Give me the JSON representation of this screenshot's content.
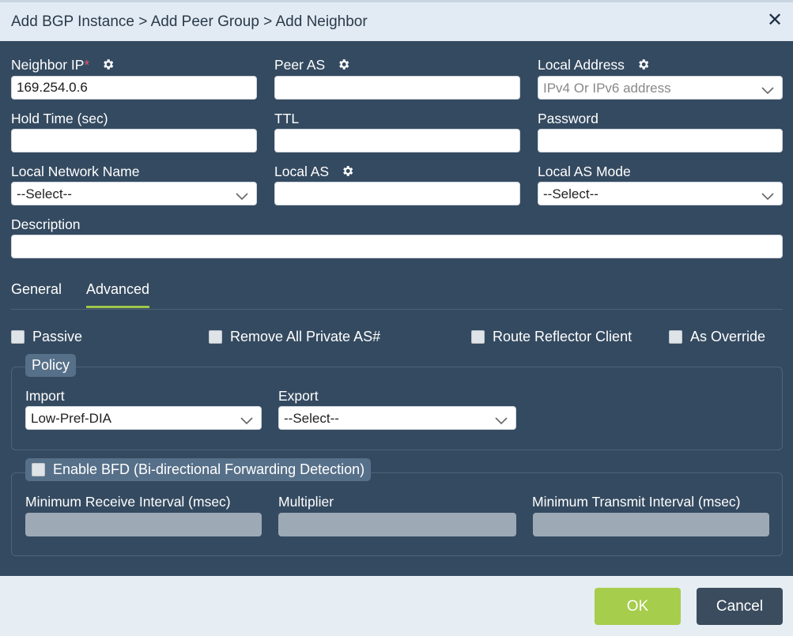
{
  "dialog": {
    "title": "Add BGP Instance > Add Peer Group > Add Neighbor",
    "close_icon": "close-icon"
  },
  "form": {
    "neighbor_ip": {
      "label": "Neighbor IP",
      "required_mark": "*",
      "value": "169.254.0.6"
    },
    "peer_as": {
      "label": "Peer AS",
      "value": ""
    },
    "local_address": {
      "label": "Local Address",
      "placeholder": "IPv4 Or IPv6 address"
    },
    "hold_time": {
      "label": "Hold Time (sec)",
      "value": ""
    },
    "ttl": {
      "label": "TTL",
      "value": ""
    },
    "password": {
      "label": "Password",
      "value": ""
    },
    "local_network_name": {
      "label": "Local Network Name",
      "selected": "--Select--"
    },
    "local_as": {
      "label": "Local AS",
      "value": ""
    },
    "local_as_mode": {
      "label": "Local AS Mode",
      "selected": "--Select--"
    },
    "description": {
      "label": "Description",
      "value": ""
    }
  },
  "tabs": [
    {
      "label": "General",
      "active": false
    },
    {
      "label": "Advanced",
      "active": true
    }
  ],
  "advanced": {
    "checkboxes": {
      "passive": {
        "label": "Passive",
        "checked": false
      },
      "remove_private_as": {
        "label": "Remove All Private AS#",
        "checked": false
      },
      "route_reflector_client": {
        "label": "Route Reflector Client",
        "checked": false
      },
      "as_override": {
        "label": "As Override",
        "checked": false
      }
    },
    "policy": {
      "legend": "Policy",
      "import": {
        "label": "Import",
        "selected": "Low-Pref-DIA"
      },
      "export": {
        "label": "Export",
        "selected": "--Select--"
      }
    },
    "bfd": {
      "legend": "Enable BFD (Bi-directional Forwarding Detection)",
      "checked": false,
      "min_receive_interval": {
        "label": "Minimum Receive Interval (msec)",
        "value": ""
      },
      "multiplier": {
        "label": "Multiplier",
        "value": ""
      },
      "min_transmit_interval": {
        "label": "Minimum Transmit Interval (msec)",
        "value": ""
      }
    }
  },
  "footer": {
    "ok_label": "OK",
    "cancel_label": "Cancel"
  },
  "colors": {
    "body_bg": "#344a60",
    "accent_green": "#a6cd4b",
    "required_red": "#e05a6a",
    "cancel_bg": "#3a4c5e"
  },
  "icons": [
    "gear-icon",
    "chevron-down-icon",
    "close-icon"
  ]
}
